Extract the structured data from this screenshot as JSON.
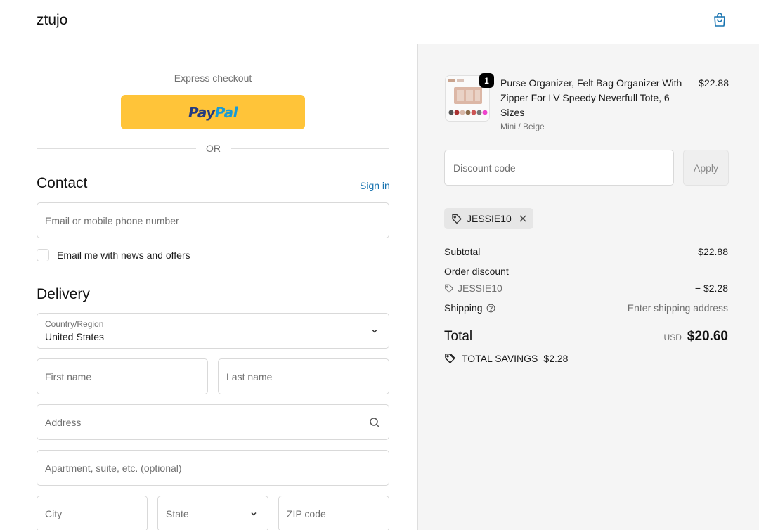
{
  "header": {
    "brand": "ztujo",
    "cart_icon": "shopping-bag-icon"
  },
  "express": {
    "label": "Express checkout",
    "paypal_part1": "Pay",
    "paypal_part2": "Pal",
    "or": "OR"
  },
  "contact": {
    "title": "Contact",
    "sign_in": "Sign in",
    "email_placeholder": "Email or mobile phone number",
    "newsletter_label": "Email me with news and offers",
    "newsletter_checked": false
  },
  "delivery": {
    "title": "Delivery",
    "country_label": "Country/Region",
    "country_value": "United States",
    "first_name_placeholder": "First name",
    "last_name_placeholder": "Last name",
    "address_placeholder": "Address",
    "apartment_placeholder": "Apartment, suite, etc. (optional)",
    "city_placeholder": "City",
    "state_placeholder": "State",
    "zip_placeholder": "ZIP code"
  },
  "summary": {
    "product": {
      "title": "Purse Organizer, Felt Bag Organizer With Zipper For LV Speedy Neverfull Tote, 6 Sizes",
      "variant": "Mini / Beige",
      "price": "$22.88",
      "quantity": "1"
    },
    "discount_placeholder": "Discount code",
    "apply_label": "Apply",
    "applied_code": "JESSIE10",
    "subtotal_label": "Subtotal",
    "subtotal_value": "$22.88",
    "order_discount_label": "Order discount",
    "order_discount_code": "JESSIE10",
    "order_discount_value": "− $2.28",
    "shipping_label": "Shipping",
    "shipping_value": "Enter shipping address",
    "total_label": "Total",
    "currency": "USD",
    "total_value": "$20.60",
    "savings_label": "TOTAL SAVINGS",
    "savings_value": "$2.28"
  },
  "colors": {
    "paypal_yellow": "#ffc439",
    "link_blue": "#1773b0",
    "cart_icon": "#1773b0"
  }
}
